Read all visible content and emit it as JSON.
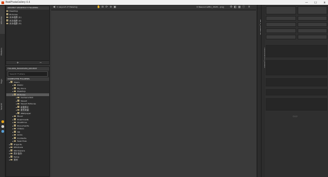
{
  "window": {
    "title": "RealPhotoGallery 0.4",
    "controls": {
      "minimize": "—",
      "maximize": "☐",
      "close": "✕"
    }
  },
  "left_tabs": {
    "items": [
      {
        "label": "Albums",
        "active": true
      },
      {
        "label": "Folders",
        "active": false
      },
      {
        "label": "Tags",
        "active": false
      },
      {
        "label": "Search",
        "active": false
      }
    ]
  },
  "albums_panel": {
    "title": "RECENT SHORTCUT FOLDERS",
    "items": [
      "Desktop",
      "Pictures",
      "共享相册 (1)",
      "共享相册 (2)",
      "共享相册 (3)"
    ],
    "footer_left": "+",
    "footer_right": "−"
  },
  "browser_panel": {
    "title": "FOLDER_BROWSER_RECENT",
    "search_placeholder": "Search Folders",
    "tree_header": "COMPUTER FOLDERS",
    "tree": [
      {
        "label": "Users",
        "depth": 0
      },
      {
        "label": "Public",
        "depth": 1
      },
      {
        "label": "My Docs",
        "depth": 1
      },
      {
        "label": "Desktop",
        "depth": 1
      },
      {
        "label": "Pictures",
        "depth": 1,
        "selected": true
      },
      {
        "label": "Camera Roll",
        "depth": 2
      },
      {
        "label": "Saved",
        "depth": 2
      },
      {
        "label": "Saved Pictures",
        "depth": 2
      },
      {
        "label": "截图照片",
        "depth": 2
      },
      {
        "label": "壁纸收藏",
        "depth": 2
      },
      {
        "label": "Wallpaper",
        "depth": 2
      },
      {
        "label": "Music",
        "depth": 1
      },
      {
        "label": "Downloads",
        "depth": 1
      },
      {
        "label": "OneDrive",
        "depth": 1
      },
      {
        "label": "Documents",
        "depth": 1
      },
      {
        "label": "Videos",
        "depth": 1
      },
      {
        "label": "3D",
        "depth": 1
      },
      {
        "label": "Links",
        "depth": 1
      },
      {
        "label": "Contacts",
        "depth": 1
      },
      {
        "label": "Searches",
        "depth": 1
      },
      {
        "label": "Projects",
        "depth": 0
      },
      {
        "label": "Windows",
        "depth": 0
      },
      {
        "label": "Workspace",
        "depth": 0
      },
      {
        "label": "照片备份",
        "depth": 0
      },
      {
        "label": "Temp",
        "depth": 0
      },
      {
        "label": "素材",
        "depth": 0
      }
    ]
  },
  "viewer": {
    "tab": "1 Layout of Viewing",
    "tab2": "0 ResourceMix_1920...png",
    "status_right": "⇐"
  },
  "right_tabs": {
    "strip1": "INFO_WINDOW",
    "strip2": "PROPERTIES_PANEL"
  }
}
